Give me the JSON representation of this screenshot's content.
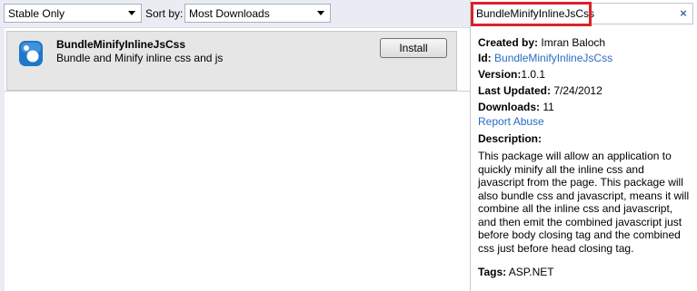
{
  "toolbar": {
    "filter_value": "Stable Only",
    "sort_label": "Sort by:",
    "sort_value": "Most Downloads"
  },
  "search": {
    "value": "BundleMinifyInlineJsCss",
    "clear_glyph": "×"
  },
  "package": {
    "name": "BundleMinifyInlineJsCss",
    "summary": "Bundle and Minify inline css and js",
    "install_label": "Install",
    "icon": "nuget-package-icon"
  },
  "details": {
    "created_by_label": "Created by:",
    "created_by": "Imran Baloch",
    "id_label": "Id:",
    "id": "BundleMinifyInlineJsCss",
    "version_label": "Version:",
    "version": "1.0.1",
    "last_updated_label": "Last Updated:",
    "last_updated": "7/24/2012",
    "downloads_label": "Downloads:",
    "downloads": "11",
    "report_abuse": "Report Abuse",
    "description_label": "Description:",
    "description": "This package will allow an application to quickly minify all the inline css and javascript from the page. This package will also bundle css and javascript, means it will combine all the inline css and javascript, and then emit the combined javascript just before body closing tag and the combined css just before head closing tag.",
    "tags_label": "Tags:",
    "tags": "ASP.NET"
  },
  "colors": {
    "link": "#2a6bc2",
    "highlight": "#d8232a",
    "row_background": "#e6e6e6",
    "toolbar_background": "#e9edf3"
  }
}
